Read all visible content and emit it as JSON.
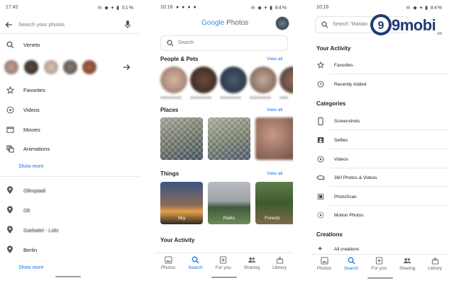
{
  "left": {
    "status": {
      "time": "17:42",
      "battery": "51%"
    },
    "search": {
      "placeholder": "Search your photos"
    },
    "query": "Veneto",
    "items": [
      {
        "label": "Favorites",
        "icon": "star-icon"
      },
      {
        "label": "Videos",
        "icon": "play-circle-icon"
      },
      {
        "label": "Movies",
        "icon": "film-icon"
      },
      {
        "label": "Animations",
        "icon": "animation-icon"
      }
    ],
    "show_more_1": "Show more",
    "places": [
      {
        "label": "Olimpiadi"
      },
      {
        "label": "Oli"
      },
      {
        "label": "Garbatel - Lido"
      },
      {
        "label": "Berlin"
      }
    ],
    "show_more_2": "Show more"
  },
  "middle": {
    "status": {
      "time": "10:16",
      "battery": "84%"
    },
    "logo": {
      "google": "Google",
      "photos": "Photos"
    },
    "search": {
      "placeholder": "Search"
    },
    "people": {
      "title": "People & Pets",
      "view_all": "View all"
    },
    "places": {
      "title": "Places",
      "view_all": "View all"
    },
    "things": {
      "title": "Things",
      "view_all": "View all",
      "items": [
        "Sky",
        "Parks",
        "Forests"
      ]
    },
    "activity": {
      "title": "Your Activity"
    },
    "nav": [
      "Photos",
      "Search",
      "For you",
      "Sharing",
      "Library"
    ],
    "active_nav": "Search"
  },
  "right": {
    "status": {
      "time": "10:16",
      "battery": "84%"
    },
    "search": {
      "placeholder": "Search \"Mariaiv..."
    },
    "watermark": {
      "main": "9mobi",
      "suffix": ".vn"
    },
    "activity": {
      "title": "Your Activity",
      "items": [
        "Favorites",
        "Recently Added"
      ]
    },
    "categories": {
      "title": "Categories",
      "items": [
        "Screenshots",
        "Selfies",
        "Videos",
        "360 Photos & Videos",
        "PhotoScan",
        "Motion Photos"
      ]
    },
    "creations": {
      "title": "Creations",
      "items": [
        "All creations"
      ]
    },
    "nav": [
      "Photos",
      "Search",
      "For you",
      "Sharing",
      "Library"
    ],
    "active_nav": "Search"
  }
}
